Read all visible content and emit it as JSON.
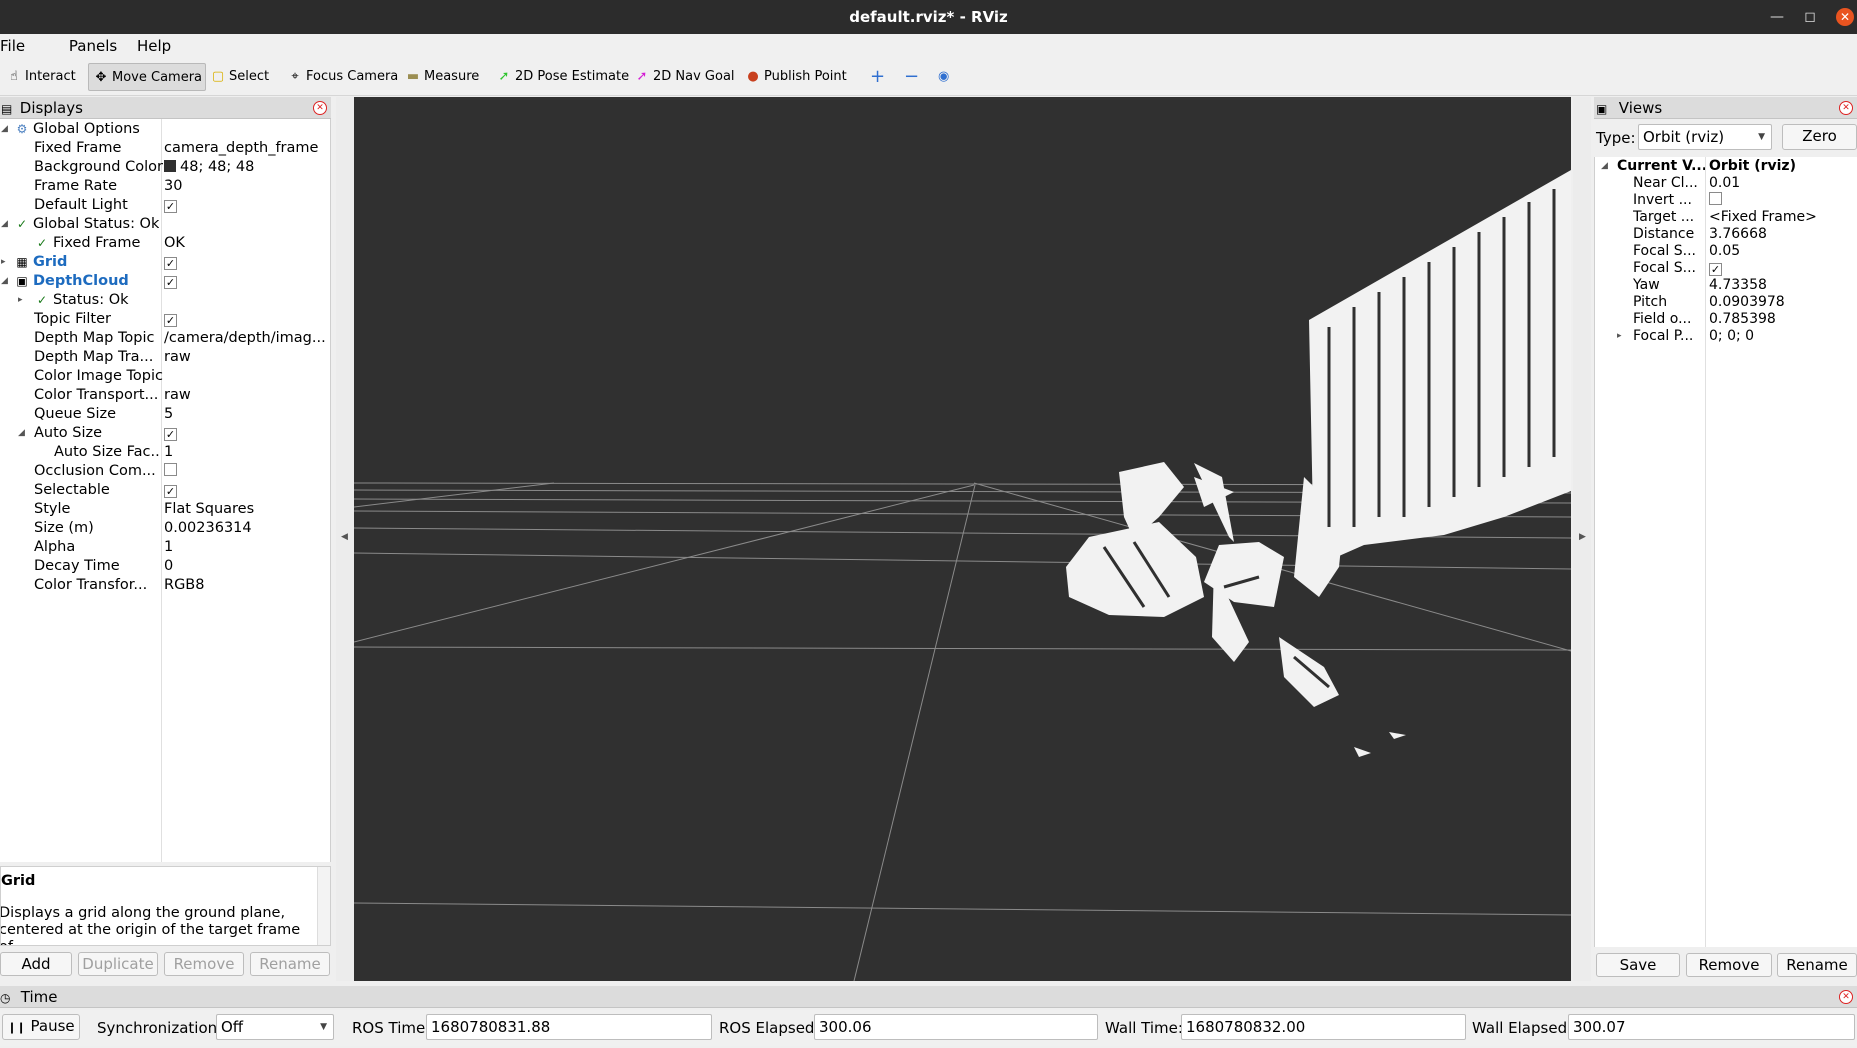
{
  "window": {
    "title": "default.rviz* - RViz"
  },
  "menu": [
    "File",
    "Panels",
    "Help"
  ],
  "toolbar": {
    "interact": "Interact",
    "move_camera": "Move Camera",
    "select": "Select",
    "focus_camera": "Focus Camera",
    "measure": "Measure",
    "pose_estimate": "2D Pose Estimate",
    "nav_goal": "2D Nav Goal",
    "publish_point": "Publish Point"
  },
  "displays": {
    "title": "Displays",
    "rows": {
      "global_options": "Global Options",
      "fixed_frame_k": "Fixed Frame",
      "fixed_frame_v": "camera_depth_frame",
      "bg_color_k": "Background Color",
      "bg_color_v": "48; 48; 48",
      "frame_rate_k": "Frame Rate",
      "frame_rate_v": "30",
      "default_light_k": "Default Light",
      "global_status": "Global Status: Ok",
      "gs_fixed_frame_k": "Fixed Frame",
      "gs_fixed_frame_v": "OK",
      "grid": "Grid",
      "depthcloud": "DepthCloud",
      "status_ok": "Status: Ok",
      "topic_filter_k": "Topic Filter",
      "depth_map_topic_k": "Depth Map Topic",
      "depth_map_topic_v": "/camera/depth/imag...",
      "depth_map_tra_k": "Depth Map Tra...",
      "depth_map_tra_v": "raw",
      "color_image_topic_k": "Color Image Topic",
      "color_transport_k": "Color Transport...",
      "color_transport_v": "raw",
      "queue_size_k": "Queue Size",
      "queue_size_v": "5",
      "auto_size_k": "Auto Size",
      "auto_size_fac_k": "Auto Size Fac...",
      "auto_size_fac_v": "1",
      "occlusion_k": "Occlusion Com...",
      "selectable_k": "Selectable",
      "style_k": "Style",
      "style_v": "Flat Squares",
      "size_k": "Size (m)",
      "size_v": "0.00236314",
      "alpha_k": "Alpha",
      "alpha_v": "1",
      "decay_k": "Decay Time",
      "decay_v": "0",
      "color_transformer_k": "Color Transfor...",
      "color_transformer_v": "RGB8"
    },
    "description": {
      "title": "Grid",
      "text": "Displays a grid along the ground plane, centered at the origin of the target frame of"
    },
    "buttons": {
      "add": "Add",
      "duplicate": "Duplicate",
      "remove": "Remove",
      "rename": "Rename"
    }
  },
  "views": {
    "title": "Views",
    "type_label": "Type:",
    "type_value": "Orbit (rviz)",
    "zero_button": "Zero",
    "rows": {
      "current_k": "Current V...",
      "current_v": "Orbit (rviz)",
      "near_k": "Near Cl...",
      "near_v": "0.01",
      "invert_k": "Invert ...",
      "target_k": "Target ...",
      "target_v": "<Fixed Frame>",
      "distance_k": "Distance",
      "distance_v": "3.76668",
      "focal_s1_k": "Focal S...",
      "focal_s1_v": "0.05",
      "focal_s2_k": "Focal S...",
      "yaw_k": "Yaw",
      "yaw_v": "4.73358",
      "pitch_k": "Pitch",
      "pitch_v": "0.0903978",
      "field_k": "Field o...",
      "field_v": "0.785398",
      "focal_p_k": "Focal P...",
      "focal_p_v": "0; 0; 0"
    },
    "buttons": {
      "save": "Save",
      "remove": "Remove",
      "rename": "Rename"
    }
  },
  "time": {
    "title": "Time",
    "pause": "Pause",
    "sync_label": "Synchronization:",
    "sync_value": "Off",
    "ros_time_label": "ROS Time:",
    "ros_time_value": "1680780831.88",
    "ros_elapsed_label": "ROS Elapsed:",
    "ros_elapsed_value": "300.06",
    "wall_time_label": "Wall Time:",
    "wall_time_value": "1680780832.00",
    "wall_elapsed_label": "Wall Elapsed:",
    "wall_elapsed_value": "300.07"
  },
  "colors": {
    "viewport_bg": "#303030",
    "title_bg": "#2c2c2c",
    "close_orange": "#e95420",
    "highlight_blue": "#1d6bbf",
    "ok_green": "#1a7a1a"
  }
}
